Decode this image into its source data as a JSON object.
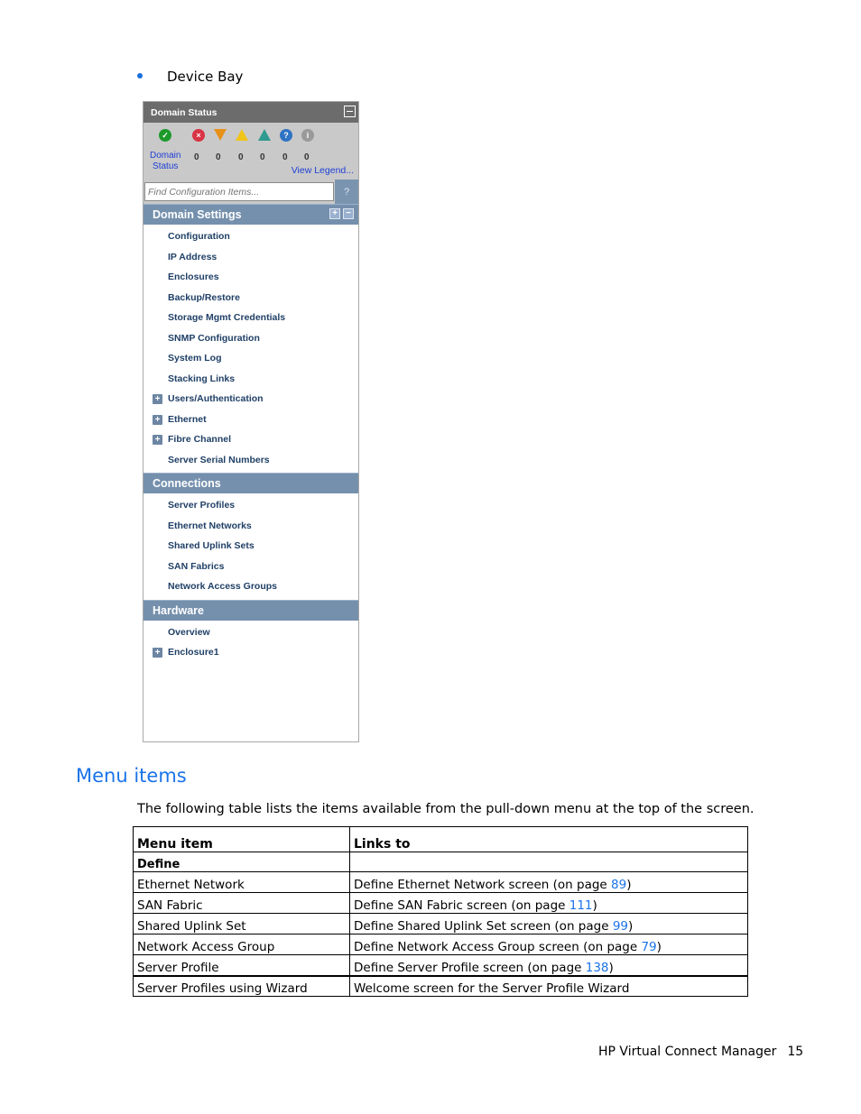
{
  "bullet": {
    "text": "Device Bay"
  },
  "panel": {
    "domain_status": {
      "title": "Domain Status",
      "label_line1": "Domain",
      "label_line2": "Status",
      "counts": [
        "0",
        "0",
        "0",
        "0",
        "0",
        "0"
      ],
      "icons": [
        "ok-check-icon",
        "critical-x-icon",
        "major-triangle-icon",
        "minor-warning-icon",
        "warning-triangle-icon",
        "unknown-question-icon",
        "info-icon"
      ],
      "view_legend": "View Legend..."
    },
    "search": {
      "placeholder": "Find Configuration Items...",
      "help": "?"
    },
    "sections": [
      {
        "title": "Domain Settings",
        "items": [
          {
            "label": "Configuration",
            "expandable": false
          },
          {
            "label": "IP Address",
            "expandable": false
          },
          {
            "label": "Enclosures",
            "expandable": false
          },
          {
            "label": "Backup/Restore",
            "expandable": false
          },
          {
            "label": "Storage Mgmt Credentials",
            "expandable": false
          },
          {
            "label": "SNMP Configuration",
            "expandable": false
          },
          {
            "label": "System Log",
            "expandable": false
          },
          {
            "label": "Stacking Links",
            "expandable": false
          },
          {
            "label": "Users/Authentication",
            "expandable": true
          },
          {
            "label": "Ethernet",
            "expandable": true
          },
          {
            "label": "Fibre Channel",
            "expandable": true
          },
          {
            "label": "Server Serial Numbers",
            "expandable": false
          }
        ]
      },
      {
        "title": "Connections",
        "items": [
          {
            "label": "Server Profiles",
            "expandable": false
          },
          {
            "label": "Ethernet Networks",
            "expandable": false
          },
          {
            "label": "Shared Uplink Sets",
            "expandable": false
          },
          {
            "label": "SAN Fabrics",
            "expandable": false
          },
          {
            "label": "Network Access Groups",
            "expandable": false
          }
        ]
      },
      {
        "title": "Hardware",
        "items": [
          {
            "label": "Overview",
            "expandable": false
          },
          {
            "label": "Enclosure1",
            "expandable": true
          }
        ]
      }
    ]
  },
  "menu_section": {
    "title": "Menu items",
    "intro": "The following table lists the items available from the pull-down menu at the top of the screen.",
    "table": {
      "headers": [
        "Menu item",
        "Links to"
      ],
      "group": "Define",
      "rows": [
        {
          "item": "Ethernet Network",
          "link_text": "Define Ethernet Network screen (on page ",
          "page": "89",
          "suffix": ")"
        },
        {
          "item": "SAN Fabric",
          "link_text": "Define SAN Fabric screen (on page ",
          "page": "111",
          "suffix": ")"
        },
        {
          "item": "Shared Uplink Set",
          "link_text": "Define Shared Uplink Set screen (on page ",
          "page": "99",
          "suffix": ")"
        },
        {
          "item": "Network Access Group",
          "link_text": "Define Network Access Group screen (on page ",
          "page": "79",
          "suffix": ")"
        },
        {
          "item": "Server Profile",
          "link_text": "Define Server Profile screen (on page ",
          "page": "138",
          "suffix": ")"
        }
      ],
      "last_row": {
        "item": "Server Profiles using Wizard",
        "link_text": "Welcome screen for the Server Profile Wizard"
      }
    }
  },
  "footer": {
    "title": "HP Virtual Connect Manager",
    "page_number": "15"
  },
  "colors": {
    "link_blue": "#1a73e8",
    "section_header": "#7590ad",
    "nav_text": "#1f3f66"
  }
}
